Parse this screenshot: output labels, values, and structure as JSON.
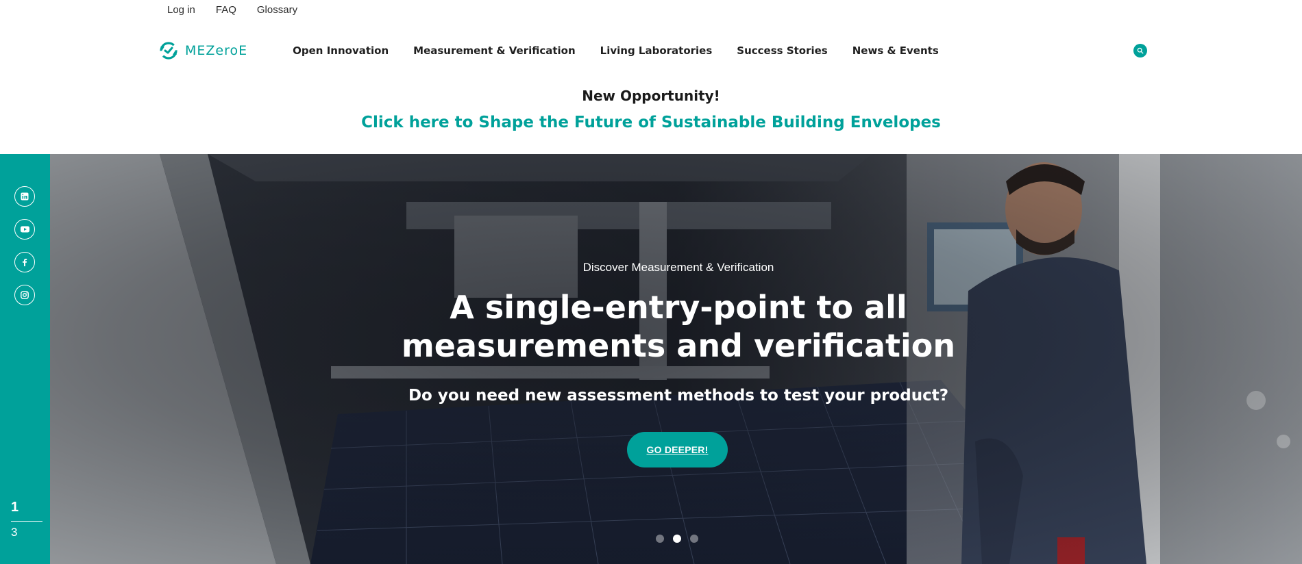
{
  "topbar": {
    "login": "Log in",
    "faq": "FAQ",
    "glossary": "Glossary"
  },
  "brand": {
    "name": "MEZeroE",
    "accent_color": "#00a19a"
  },
  "nav": {
    "items": [
      {
        "label": "Open Innovation"
      },
      {
        "label": "Measurement & Verification"
      },
      {
        "label": "Living Laboratories"
      },
      {
        "label": "Success Stories"
      },
      {
        "label": "News & Events"
      }
    ],
    "search_icon": "search-icon"
  },
  "announcement": {
    "kicker": "New Opportunity!",
    "link": "Click here to Shape the Future of Sustainable Building Envelopes"
  },
  "social": [
    {
      "icon": "linkedin-icon"
    },
    {
      "icon": "youtube-icon"
    },
    {
      "icon": "facebook-icon"
    },
    {
      "icon": "instagram-icon"
    }
  ],
  "hero": {
    "eyebrow": "Discover Measurement & Verification",
    "headline_line1": "A single-entry-point to all",
    "headline_line2": "measurements and verification",
    "subhead": "Do you need new assessment methods to test your product?",
    "button": "GO DEEPER!",
    "current_slide": "1",
    "total_slides": "3",
    "dot_count": 3,
    "active_dot": 2
  }
}
